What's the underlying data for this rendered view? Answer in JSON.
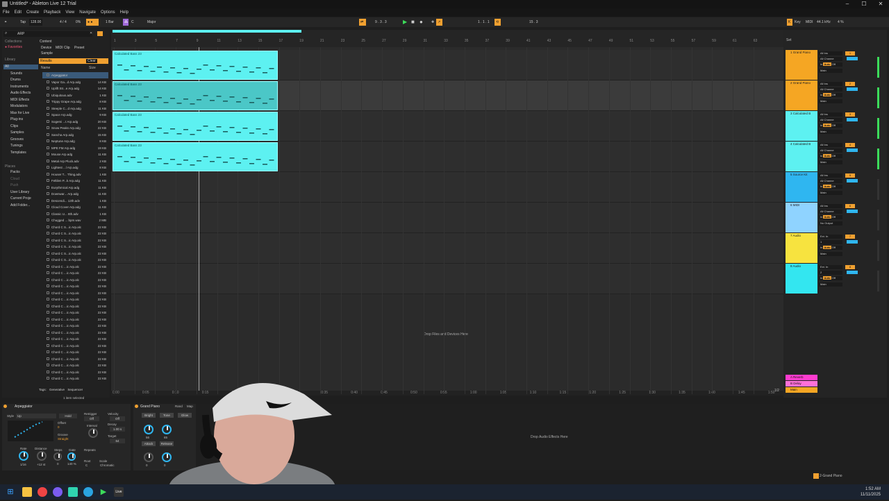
{
  "window": {
    "title": "Untitled* - Ableton Live 12 Trial",
    "controls": [
      "–",
      "☐",
      "✕"
    ]
  },
  "menu": [
    "File",
    "Edit",
    "Create",
    "Playback",
    "View",
    "Navigate",
    "Options",
    "Help"
  ],
  "control_bar": {
    "tap": "Tap",
    "tempo": "128.00",
    "signature": "4 / 4",
    "quant_pct": "0%",
    "bar_quant": "1 Bar",
    "key_root": "C",
    "scale": "Major",
    "position": "9 . 3 . 3",
    "loop_start": "1 . 1 . 1",
    "loop_length": "15 . 3",
    "key_label": "Key",
    "midi_label": "MIDI",
    "sample_rate": "44.1 kHz",
    "cpu": "4 %"
  },
  "browser": {
    "search": "ARP",
    "collections_header": "Collections",
    "favorites": "Favorites",
    "tabs": [
      "Content",
      "Device",
      "MIDI Clip",
      "Preset",
      "Sample"
    ],
    "library_header": "Library",
    "library_items": [
      "All",
      "Sounds",
      "Drums",
      "Instruments",
      "Audio Effects",
      "MIDI Effects",
      "Modulators",
      "Max for Live",
      "Plug-ins",
      "Clips",
      "Samples",
      "Grooves",
      "Tunings",
      "Templates"
    ],
    "places_header": "Places",
    "places_items": [
      "Packs",
      "Cloud",
      "Push",
      "User Library",
      "Current Proje",
      "Add Folder..."
    ],
    "results_label": "Results",
    "clear_label": "Clear",
    "col_name": "Name",
    "col_size": "Size",
    "results": [
      {
        "name": "Arpeggiator",
        "size": ""
      },
      {
        "name": "Vapor Ga...d Arp.adg",
        "size": "14 KB"
      },
      {
        "name": "Uplift Str...e Arp.adg",
        "size": "14 KB"
      },
      {
        "name": "Ubiquitous.adv",
        "size": "1 KB"
      },
      {
        "name": "Trippy Grape Arp.adg",
        "size": "8 KB"
      },
      {
        "name": "Steeple C...d Arp.adg",
        "size": "11 KB"
      },
      {
        "name": "Space Arp.adg",
        "size": "9 KB"
      },
      {
        "name": "Sogemi ...t Arp.adg",
        "size": "20 KB"
      },
      {
        "name": "Snow Peaks Arp.adg",
        "size": "22 KB"
      },
      {
        "name": "Sancha Arp.adg",
        "size": "15 KB"
      },
      {
        "name": "Neptune Arp.adg",
        "size": "8 KB"
      },
      {
        "name": "MPE FM Arp.adg",
        "size": "19 KB"
      },
      {
        "name": "Mouse Arp.adg",
        "size": "11 KB"
      },
      {
        "name": "Metal Arp Pluck.adv",
        "size": "2 KB"
      },
      {
        "name": "Lightest ...l Arp.adg",
        "size": "8 KB"
      },
      {
        "name": "Houser T... Thing.adv",
        "size": "1 KB"
      },
      {
        "name": "Feltilen P...k Arp.adg",
        "size": "11 KB"
      },
      {
        "name": "Eurythmical Arp.adg",
        "size": "11 KB"
      },
      {
        "name": "Downwar... Arp.adg",
        "size": "11 KB"
      },
      {
        "name": "Descendi... 12th.adv",
        "size": "1 KB"
      },
      {
        "name": "Cloud Cover Arp.adg",
        "size": "11 KB"
      },
      {
        "name": "Classic U... 8th.adv",
        "size": "1 KB"
      },
      {
        "name": "Chugged ... bpm.wav",
        "size": "2 MB"
      },
      {
        "name": "Chord C S...ic Arp.alc",
        "size": "22 KB"
      },
      {
        "name": "Chord C S...ic Arp.alc",
        "size": "22 KB"
      },
      {
        "name": "Chord C S...ic Arp.alc",
        "size": "22 KB"
      },
      {
        "name": "Chord C S...ic Arp.alc",
        "size": "22 KB"
      },
      {
        "name": "Chord C S...ic Arp.alc",
        "size": "22 KB"
      },
      {
        "name": "Chord C S...ic Arp.alc",
        "size": "22 KB"
      },
      {
        "name": "Chord C ...ic Arp.alc",
        "size": "22 KB"
      },
      {
        "name": "Chord C ...ic Arp.alc",
        "size": "22 KB"
      },
      {
        "name": "Chord C ...ic Arp.alc",
        "size": "22 KB"
      },
      {
        "name": "Chord C ...ic Arp.alc",
        "size": "22 KB"
      },
      {
        "name": "Chord C ...ic Arp.alc",
        "size": "22 KB"
      },
      {
        "name": "Chord C ...ic Arp.alc",
        "size": "22 KB"
      },
      {
        "name": "Chord C ...ic Arp.alc",
        "size": "22 KB"
      },
      {
        "name": "Chord C ...ic Arp.alc",
        "size": "22 KB"
      },
      {
        "name": "Chord C ...ic Arp.alc",
        "size": "22 KB"
      },
      {
        "name": "Chord C ...ic Arp.alc",
        "size": "22 KB"
      },
      {
        "name": "Chord C ...ic Arp.alc",
        "size": "22 KB"
      },
      {
        "name": "Chord C ...ic Arp.alc",
        "size": "22 KB"
      },
      {
        "name": "Chord C ...ic Arp.alc",
        "size": "22 KB"
      },
      {
        "name": "Chord C ...ic Arp.alc",
        "size": "22 KB"
      },
      {
        "name": "Chord C ...ic Arp.alc",
        "size": "22 KB"
      },
      {
        "name": "Chord C ...ic Arp.alc",
        "size": "22 KB"
      },
      {
        "name": "Chord C ...ic Arp.alc",
        "size": "22 KB"
      },
      {
        "name": "Chord C ...ic Arp.alc",
        "size": "22 KB"
      }
    ],
    "bottom_tags": [
      "Tags:",
      "Generative",
      "Sequencer"
    ],
    "status": "1 item selected"
  },
  "arrangement": {
    "ruler_bars": [
      "1",
      "3",
      "5",
      "7",
      "9",
      "11",
      "13",
      "15",
      "17",
      "19",
      "21",
      "23",
      "25",
      "27",
      "29",
      "31",
      "33",
      "35",
      "37",
      "39",
      "41",
      "43",
      "45",
      "47",
      "49",
      "51",
      "53",
      "55",
      "57",
      "59",
      "61",
      "63"
    ],
    "time_labels": [
      "0:00",
      "0:05",
      "0:10",
      "0:15",
      "0:20",
      "0:25",
      "0:30",
      "0:35",
      "0:40",
      "0:45",
      "0:50",
      "0:55",
      "1:00",
      "1:05",
      "1:10",
      "1:15",
      "1:20",
      "1:25",
      "1:30",
      "1:35",
      "1:40",
      "1:45",
      "1:50"
    ],
    "clip_name": "Calculated Bass 23",
    "drop_text": "Drop Files and Devices Here",
    "zoom": "1/2"
  },
  "tracks": [
    {
      "name": "1 Grand Piano",
      "color": "#f5a623",
      "input": "All Ins",
      "channel": "All Channe",
      "num": "1",
      "output": "Main"
    },
    {
      "name": "2 Grand Piano",
      "color": "#f5a623",
      "input": "All Ins",
      "channel": "All Channe",
      "num": "2",
      "output": "Main"
    },
    {
      "name": "3 Calculated B",
      "color": "#5df1f1",
      "input": "All Ins",
      "channel": "All Channe",
      "num": "3",
      "output": "Main"
    },
    {
      "name": "4 Calculated B",
      "color": "#5df1f1",
      "input": "All Ins",
      "channel": "All Channe",
      "num": "4",
      "output": "Main"
    },
    {
      "name": "5 Source Kit",
      "color": "#2fb6f0",
      "input": "All Ins",
      "channel": "All Channe",
      "num": "5",
      "output": "Main"
    },
    {
      "name": "6 MIDI",
      "color": "#8fd3ff",
      "input": "All Ins",
      "channel": "All Channe",
      "num": "6",
      "output": "No Output"
    },
    {
      "name": "7 Audio",
      "color": "#f7e33f",
      "input": "Ext. In",
      "channel": "1",
      "num": "7",
      "output": "Main"
    },
    {
      "name": "8 Audio",
      "color": "#33e6f0",
      "input": "Ext. In",
      "channel": "2",
      "num": "8",
      "output": "Main"
    }
  ],
  "returns": [
    {
      "name": "A Reverb",
      "color": "#ff3ccf"
    },
    {
      "name": "B Delay",
      "color": "#ff70d8"
    },
    {
      "name": "Main",
      "color": "#f5a623"
    }
  ],
  "device_view": {
    "arp_title": "Arpeggiator",
    "style_label": "Style",
    "style_value": "Up",
    "hold": "Hold",
    "offset_label": "Offset",
    "offset_value": "0",
    "groove_label": "Groove",
    "groove_value": "Straight",
    "retrigger_label": "Retrigger",
    "retrigger_value": "Off",
    "velocity_label": "Velocity",
    "velocity_value": "Off",
    "interval_label": "Interval",
    "decay_label": "Decay",
    "decay_value": "1.00 s",
    "target_label": "Target",
    "target_value": "64",
    "rate_label": "Rate",
    "rate_value": "1/16",
    "distance_label": "Distance",
    "distance_value": "+12 st",
    "steps_label": "Steps",
    "steps_value": "0",
    "gate_label": "Gate",
    "gate_value": "140 %",
    "repeats_label": "Repeats",
    "root_label": "Root",
    "root_value": "C",
    "scale_label": "Scale",
    "scale_value": "Chromatic",
    "piano_title": "Grand Piano",
    "rand": "Rand",
    "map": "Map",
    "piano_buttons": [
      "Bright",
      "Tone",
      "Glow",
      "Attack",
      "Release"
    ],
    "piano_values": [
      "56",
      "65",
      "0",
      "0"
    ],
    "drop_text": "Drop Audio Effects Here",
    "bottom_track": "2-Grand Piano"
  },
  "taskbar": {
    "time": "1:52 AM",
    "date": "11/11/2025"
  }
}
